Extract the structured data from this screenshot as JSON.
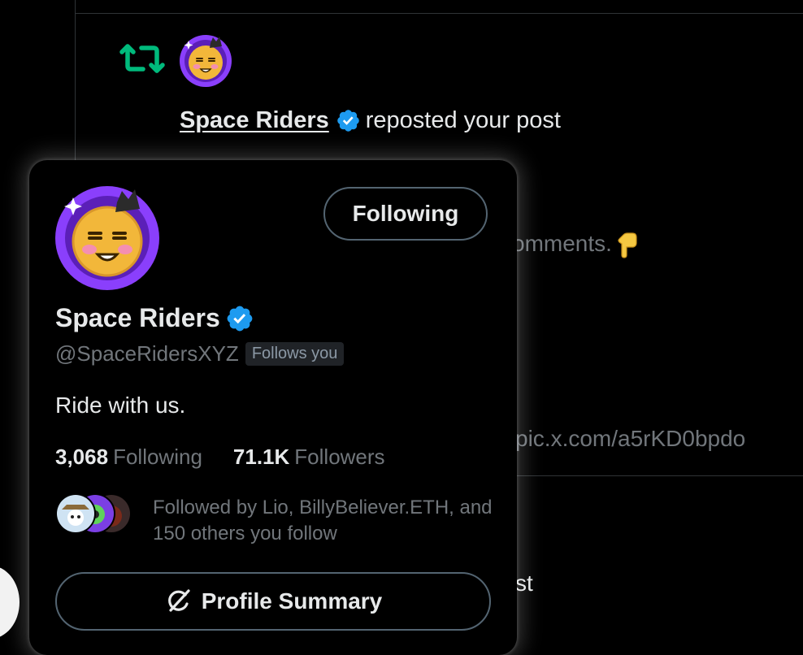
{
  "notification": {
    "name": "Space Riders",
    "action": "reposted your post"
  },
  "background_post": {
    "comments_fragment": "omments.",
    "link_fragment": "pic.x.com/a5rKD0bpdo",
    "trailing_fragment": "st"
  },
  "hover_card": {
    "follow_button_label": "Following",
    "display_name": "Space Riders",
    "handle": "@SpaceRidersXYZ",
    "follows_you_badge": "Follows you",
    "bio": "Ride with us.",
    "following_count": "3,068",
    "following_label": "Following",
    "followers_count": "71.1K",
    "followers_label": "Followers",
    "followed_by_text": "Followed by Lio, BillyBeliever.ETH, and 150 others you follow",
    "summary_button_label": "Profile Summary"
  },
  "colors": {
    "background": "#000000",
    "primary_text": "#e7e9ea",
    "secondary_text": "#71767b",
    "border": "#536471",
    "repost_green": "#00ba7c",
    "verified_blue": "#1d9bf0",
    "avatar_purple": "#8a3ffc",
    "avatar_gold": "#f2b73a"
  },
  "icons": {
    "repost": "repost-icon",
    "verified": "verified-badge-icon",
    "point_down": "backhand-index-pointing-down-emoji",
    "grok": "grok-icon"
  }
}
